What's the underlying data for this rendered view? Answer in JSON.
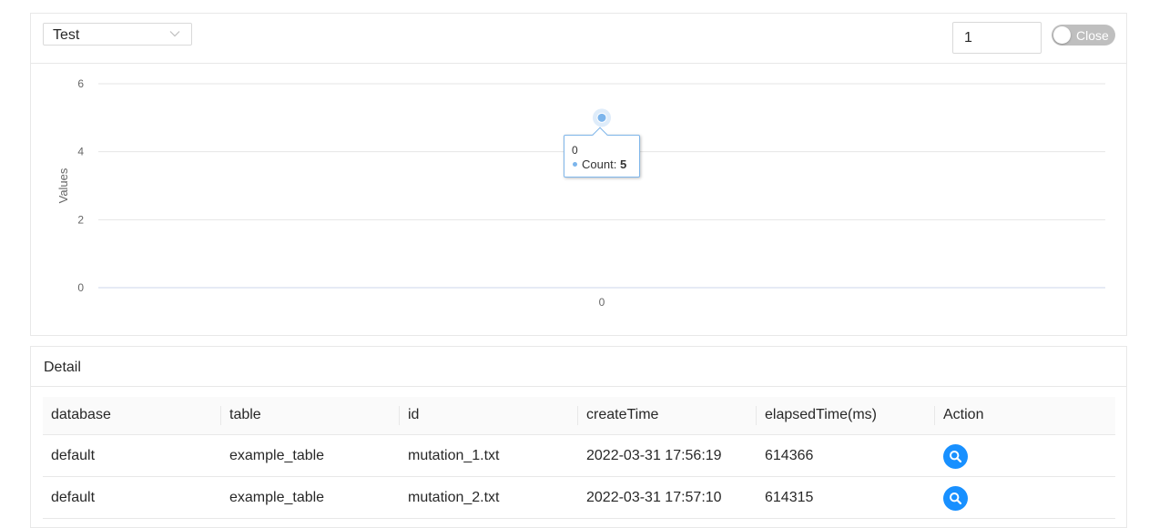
{
  "filter": {
    "selected": "Test"
  },
  "count_input": {
    "value": "1"
  },
  "toggle": {
    "label": "Close",
    "on": false
  },
  "chart_data": {
    "type": "scatter",
    "title": "",
    "xlabel": "",
    "ylabel": "Values",
    "x_categories": [
      "0"
    ],
    "y_ticks": [
      0,
      2,
      4,
      6
    ],
    "ylim": [
      0,
      6
    ],
    "grid": true,
    "series": [
      {
        "name": "Count",
        "color": "#7cb5ec",
        "points": [
          {
            "x": "0",
            "y": 5
          }
        ]
      }
    ],
    "tooltip": {
      "category": "0",
      "series_label": "Count:",
      "value": "5"
    }
  },
  "detail": {
    "title": "Detail",
    "columns": [
      "database",
      "table",
      "id",
      "createTime",
      "elapsedTime(ms)",
      "Action"
    ],
    "rows": [
      [
        "default",
        "example_table",
        "mutation_1.txt",
        "2022-03-31 17:56:19",
        "614366"
      ],
      [
        "default",
        "example_table",
        "mutation_2.txt",
        "2022-03-31 17:57:10",
        "614315"
      ]
    ],
    "action_icon": "search-icon",
    "accent": "#1890ff"
  }
}
